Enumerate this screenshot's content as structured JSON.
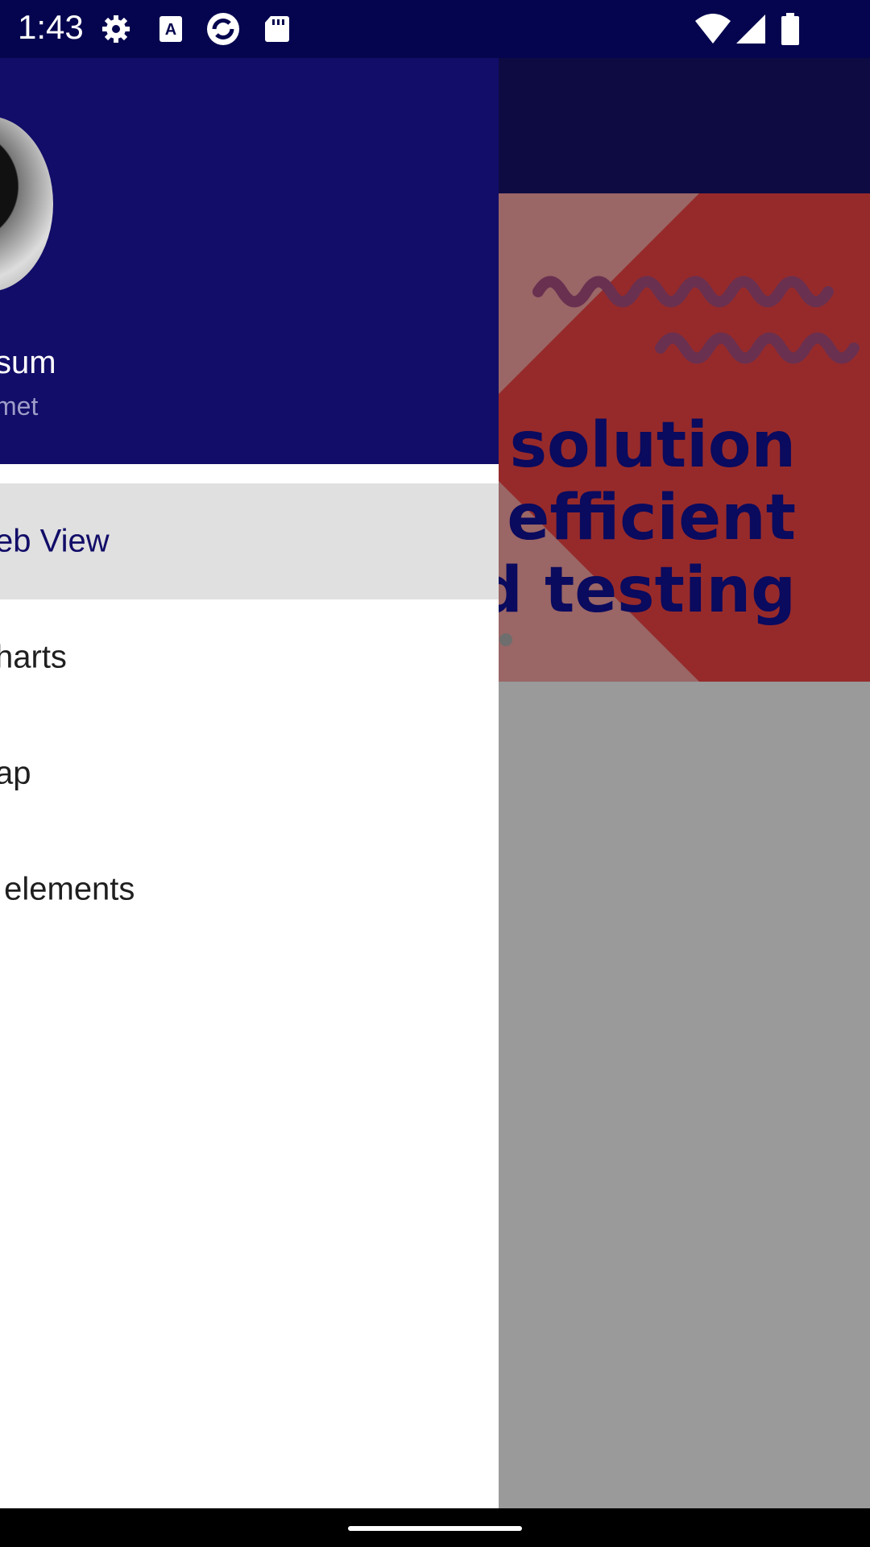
{
  "status_bar": {
    "time": "1:43",
    "icons_left": [
      "settings-icon",
      "text-a-icon",
      "sync-app-icon",
      "sd-card-icon"
    ],
    "icons_right": [
      "wifi-icon",
      "signal-icon",
      "battery-icon"
    ]
  },
  "background_app": {
    "banner_lines": [
      "va solution",
      "or efficient",
      "ced testing"
    ]
  },
  "drawer": {
    "header": {
      "title": "sum",
      "subtitle": "met"
    },
    "items": [
      {
        "label": "eb View",
        "selected": true
      },
      {
        "label": "harts",
        "selected": false
      },
      {
        "label": "ap",
        "selected": false
      },
      {
        "label": " elements",
        "selected": false
      }
    ]
  },
  "colors": {
    "status_bar": "#05054f",
    "drawer_header": "#120d68",
    "selected_item_bg": "#e0e0e0",
    "scrim": "#9a9a9a",
    "banner_red": "#962a2a"
  }
}
